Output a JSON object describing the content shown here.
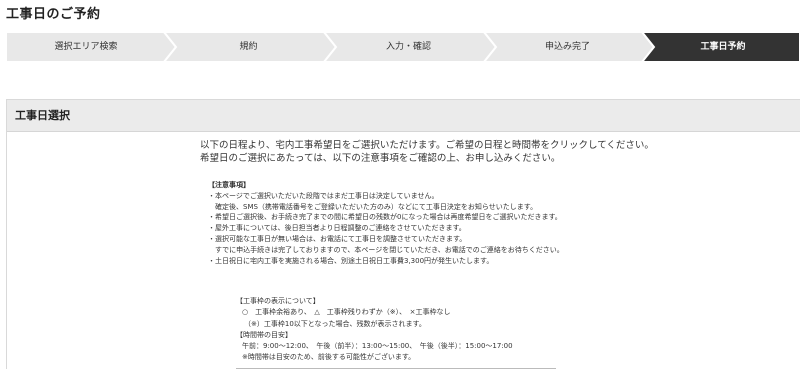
{
  "page": {
    "title": "工事日のご予約"
  },
  "steps": [
    {
      "label": "選択エリア検索",
      "active": false
    },
    {
      "label": "規約",
      "active": false
    },
    {
      "label": "入力・確認",
      "active": false
    },
    {
      "label": "申込み完了",
      "active": false
    },
    {
      "label": "工事日予約",
      "active": true
    }
  ],
  "colors": {
    "step_bg": "#e8e8e8",
    "step_active": "#333333",
    "header_bg": "#ebebeb"
  },
  "panel": {
    "title": "工事日選択"
  },
  "intro": {
    "line1": "以下の日程より、宅内工事希望日をご選択いただけます。ご希望の日程と時間帯をクリックしてください。",
    "line2": "希望日のご選択にあたっては、以下の注意事項をご確認の上、お申し込みください。"
  },
  "notice": {
    "title": "【注意事項】",
    "lines": [
      "・本ページでご選択いただいた段階ではまだ工事日は決定していません。",
      "確定後、SMS（携帯電話番号をご登録いただいた方のみ）などにて工事日決定をお知らせいたします。",
      "・希望日ご選択後、お手続き完了までの間に希望日の残数が0になった場合は再度希望日をご選択いただきます。",
      "・屋外工事については、後日担当者より日程調整のご連絡をさせていただきます。",
      "・選択可能な工事日が無い場合は、お電話にて工事日を調整させていただきます。",
      "すでに申込手続きは完了しておりますので、本ページを閉じていただき、お電話でのご連絡をお待ちください。",
      "・土日祝日に宅内工事を実施される場合、別途土日祝日工事費3,300円が発生いたします。"
    ]
  },
  "legend": {
    "title": "【工事枠の表示について】",
    "symbols": "○　工事枠余裕あり、　△　工事枠残りわずか（※）、　×工事枠なし",
    "note": "（※）工事枠10以下となった場合、残数が表示されます。",
    "time_title": "【時間帯の目安】",
    "times": "午前：9:00～12:00、　午後（前半）：13:00～15:00、　午後（後半）：15:00～17:00",
    "time_note": "※時間帯は目安のため、前後する可能性がございます。"
  }
}
